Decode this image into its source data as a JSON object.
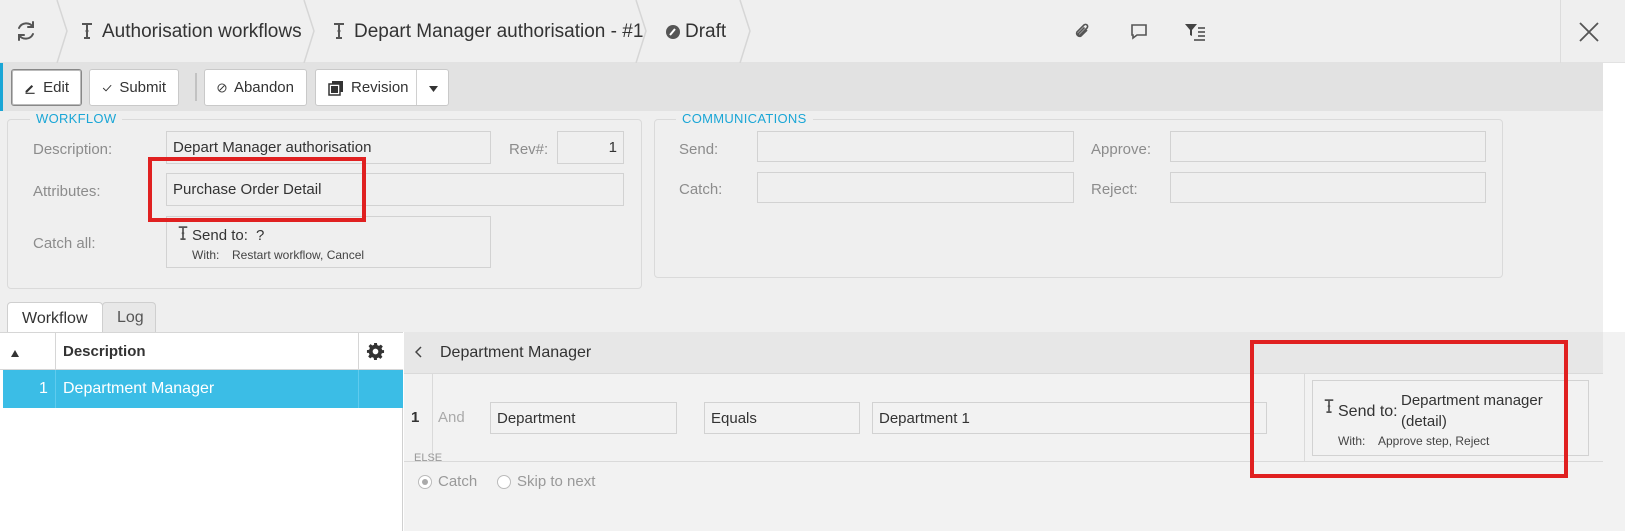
{
  "breadcrumbs": {
    "workflows": "Authorisation workflows",
    "item": "Depart Manager authorisation - #1",
    "status": "Draft"
  },
  "toolbar": {
    "edit": "Edit",
    "submit": "Submit",
    "abandon": "Abandon",
    "revision": "Revision"
  },
  "workflow_panel": {
    "legend": "WORKFLOW",
    "description_label": "Description:",
    "description_value": "Depart Manager authorisation",
    "rev_label": "Rev#:",
    "rev_value": "1",
    "attributes_label": "Attributes:",
    "attributes_value": "Purchase Order Detail",
    "catch_all_label": "Catch all:",
    "catch_send_to": "Send to:",
    "catch_send_value": "?",
    "catch_with_label": "With:",
    "catch_with_value": "Restart workflow, Cancel"
  },
  "communications_panel": {
    "legend": "COMMUNICATIONS",
    "send_label": "Send:",
    "approve_label": "Approve:",
    "catch_label": "Catch:",
    "reject_label": "Reject:"
  },
  "tabs": {
    "workflow": "Workflow",
    "log": "Log"
  },
  "grid": {
    "header_description": "Description",
    "rows": [
      {
        "num": "1",
        "description": "Department Manager"
      }
    ]
  },
  "detail": {
    "title": "Department Manager",
    "row_num": "1",
    "and_label": "And",
    "field": "Department",
    "operator": "Equals",
    "value": "Department 1",
    "send_to_label": "Send to:",
    "send_to_value_line1": "Department manager",
    "send_to_value_line2": "(detail)",
    "with_label": "With:",
    "with_value": "Approve step, Reject",
    "else_label": "ELSE",
    "catch_option": "Catch",
    "skip_option": "Skip to next"
  },
  "colors": {
    "accent": "#1aa6d6",
    "selected_row": "#3bbde6",
    "highlight": "#e02020"
  }
}
